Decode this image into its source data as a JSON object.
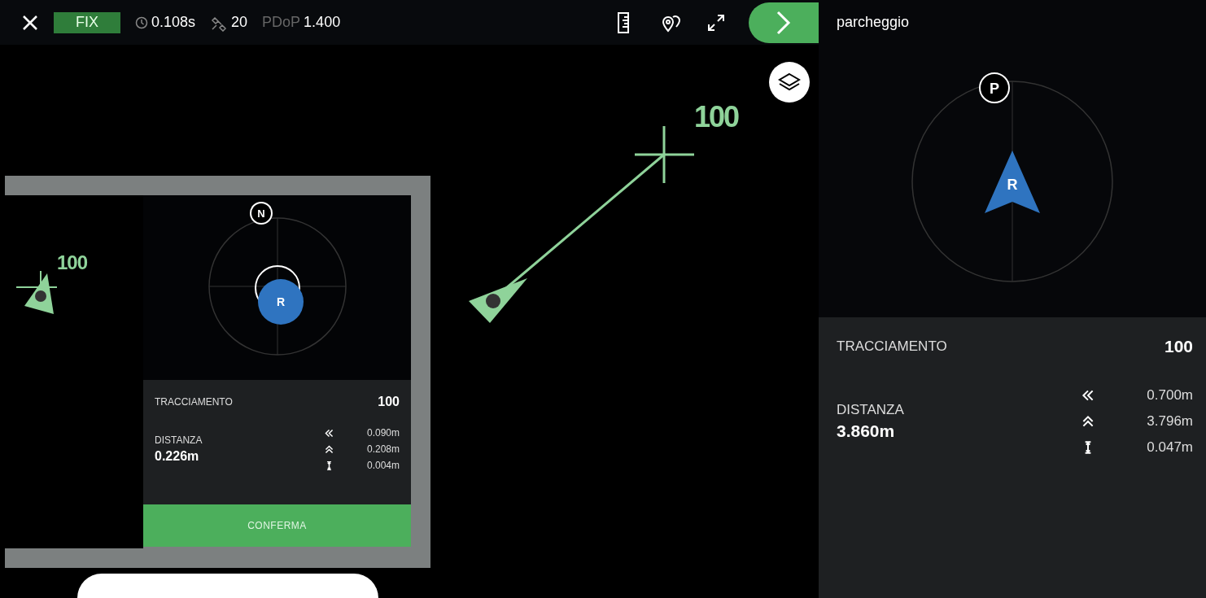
{
  "toolbar": {
    "fix_status": "FIX",
    "latency": "0.108s",
    "satellites": "20",
    "pdop_label": "PDoP",
    "pdop_value": "1.400"
  },
  "map": {
    "target_label": "100"
  },
  "inset": {
    "target_label": "100",
    "compass_mark": "N",
    "rover": "R",
    "tracking_label": "TRACCIAMENTO",
    "tracking_value": "100",
    "distance_label": "DISTANZA",
    "distance_value": "0.226m",
    "offsets": [
      {
        "kind": "left",
        "value": "0.090m"
      },
      {
        "kind": "forward",
        "value": "0.208m"
      },
      {
        "kind": "height",
        "value": "0.004m"
      }
    ],
    "confirm": "CONFERMA"
  },
  "panel": {
    "title": "parcheggio",
    "compass_mark": "P",
    "rover": "R",
    "tracking_label": "TRACCIAMENTO",
    "tracking_value": "100",
    "distance_label": "DISTANZA",
    "distance_value": "3.860m",
    "offsets": [
      {
        "kind": "left",
        "value": "0.700m"
      },
      {
        "kind": "forward",
        "value": "3.796m"
      },
      {
        "kind": "height",
        "value": "0.047m"
      }
    ]
  }
}
